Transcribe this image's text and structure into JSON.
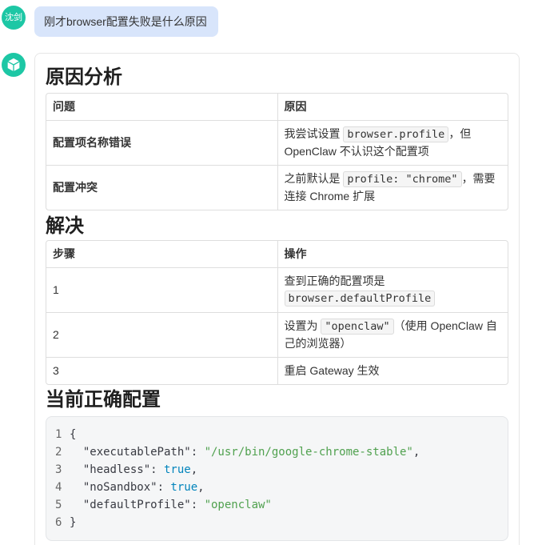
{
  "user_message": {
    "avatar_label": "沈剑",
    "text": "刚才browser配置失败是什么原因"
  },
  "assistant_message": {
    "avatar_icon": "cube-icon",
    "cause_section": {
      "title": "原因分析",
      "headers": [
        "问题",
        "原因"
      ],
      "rows": [
        {
          "issue": "配置项名称错误",
          "reason": {
            "before": "我尝试设置 ",
            "code": "browser.profile",
            "after": "，但 OpenClaw 不认识这个配置项"
          }
        },
        {
          "issue": "配置冲突",
          "reason": {
            "before": "之前默认是 ",
            "code": "profile: \"chrome\"",
            "after": "，需要连接 Chrome 扩展"
          }
        }
      ]
    },
    "solution_section": {
      "title": "解决",
      "headers": [
        "步骤",
        "操作"
      ],
      "rows": [
        {
          "step": "1",
          "action": {
            "before": "查到正确的配置项是 ",
            "code": "browser.defaultProfile"
          }
        },
        {
          "step": "2",
          "action": {
            "before": "设置为 ",
            "code": "\"openclaw\"",
            "after": "（使用 OpenClaw 自己的浏览器）"
          }
        },
        {
          "step": "3",
          "action": {
            "text": "重启 Gateway 生效"
          }
        }
      ]
    },
    "config_section": {
      "title": "当前正确配置",
      "code_lines": [
        {
          "num": "1",
          "text": "{"
        },
        {
          "num": "2",
          "key": "\"executablePath\"",
          "colon": ": ",
          "value": "\"/usr/bin/google-chrome-stable\"",
          "comma": ","
        },
        {
          "num": "3",
          "key": "\"headless\"",
          "colon": ": ",
          "value": "true",
          "comma": ","
        },
        {
          "num": "4",
          "key": "\"noSandbox\"",
          "colon": ": ",
          "value": "true",
          "comma": ","
        },
        {
          "num": "5",
          "key": "\"defaultProfile\"",
          "colon": ": ",
          "value": "\"openclaw\""
        },
        {
          "num": "6",
          "text": "}"
        }
      ]
    }
  },
  "colors": {
    "avatar_bg": "#1dc7a5",
    "user_bubble_bg": "#d8e5fb",
    "code_block_bg": "#f5f6f7",
    "code_string": "#50a14f",
    "code_boolean": "#0184bc",
    "table_border": "#dedede"
  }
}
